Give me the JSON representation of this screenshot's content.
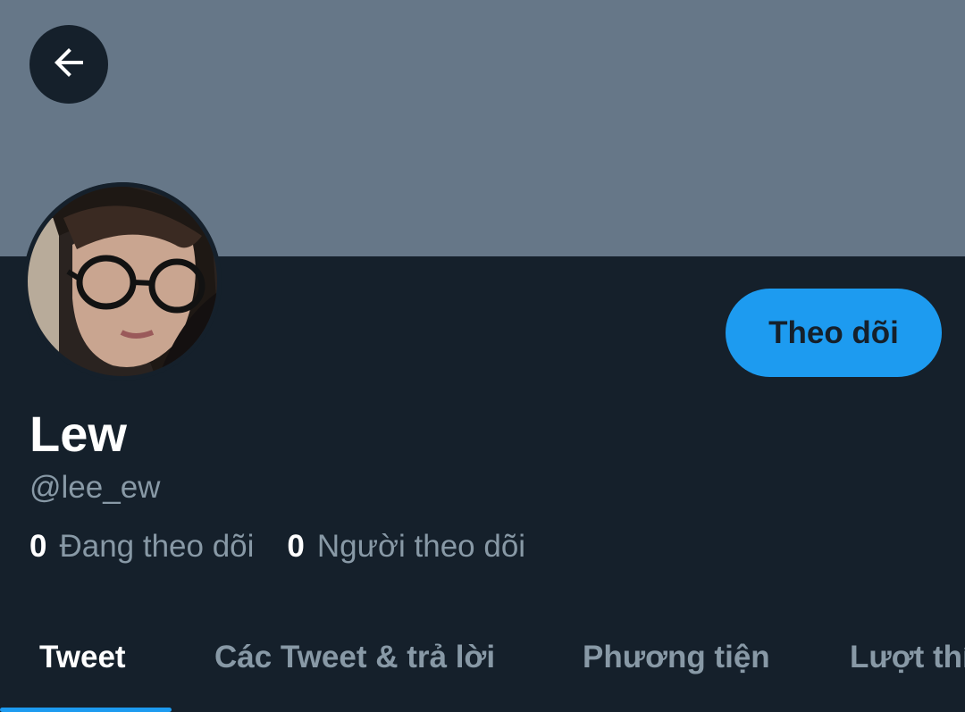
{
  "header": {
    "banner_color": "#667788",
    "back_icon": "arrow-left-icon"
  },
  "profile": {
    "avatar": "profile-photo",
    "display_name": "Lew",
    "handle": "@lee_ew",
    "follow_label": "Theo dõi",
    "following_count": "0",
    "following_label": "Đang theo dõi",
    "followers_count": "0",
    "followers_label": "Người theo dõi"
  },
  "tabs": [
    {
      "label": "Tweet",
      "active": true
    },
    {
      "label": "Các Tweet & trả lời",
      "active": false
    },
    {
      "label": "Phương tiện",
      "active": false
    },
    {
      "label": "Lượt thích",
      "active": false
    }
  ],
  "colors": {
    "background": "#15202b",
    "accent": "#1d9bf0",
    "secondary_text": "#8899a6",
    "primary_text": "#ffffff"
  }
}
